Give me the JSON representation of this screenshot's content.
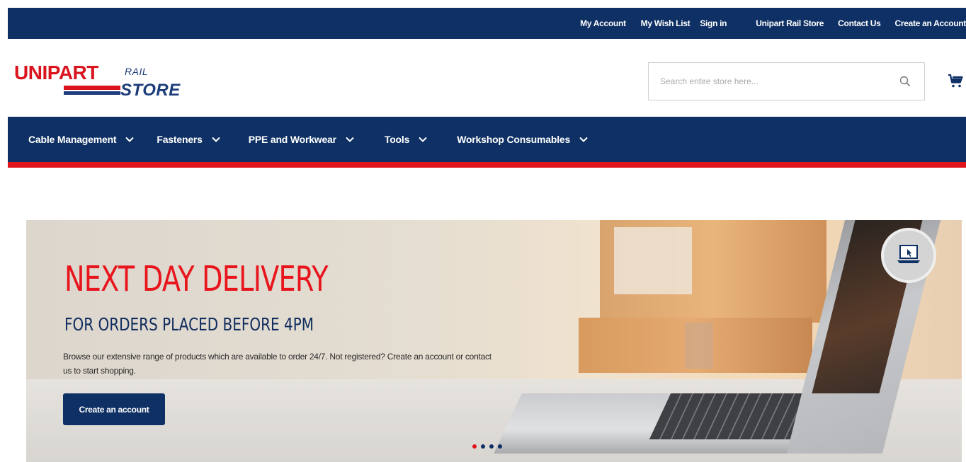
{
  "top_links": [
    {
      "label": "My Account"
    },
    {
      "label": "My Wish List"
    },
    {
      "label": "Sign in"
    },
    {
      "label": "Unipart Rail Store"
    },
    {
      "label": "Contact Us"
    },
    {
      "label": "Create an Account"
    }
  ],
  "logo": {
    "brand": "UNIPART",
    "rail": "RAIL",
    "store": "STORE"
  },
  "search": {
    "placeholder": "Search entire store here...",
    "icon": "search-icon"
  },
  "cart": {
    "icon": "shopping-cart-icon"
  },
  "nav": [
    {
      "label": "Cable Management"
    },
    {
      "label": "Fasteners"
    },
    {
      "label": "PPE and Workwear"
    },
    {
      "label": "Tools"
    },
    {
      "label": "Workshop Consumables"
    }
  ],
  "hero": {
    "title": "NEXT DAY DELIVERY",
    "subtitle": "FOR ORDERS PLACED BEFORE 4PM",
    "text": "Browse our extensive range of products which are available to order 24/7. Not registered? Create an account or contact us to start shopping.",
    "button_label": "Create an account",
    "badge_icon": "laptop-click-icon",
    "slides": 4,
    "active_slide": 1
  },
  "colors": {
    "navy": "#0e3064",
    "red": "#e0151b"
  }
}
